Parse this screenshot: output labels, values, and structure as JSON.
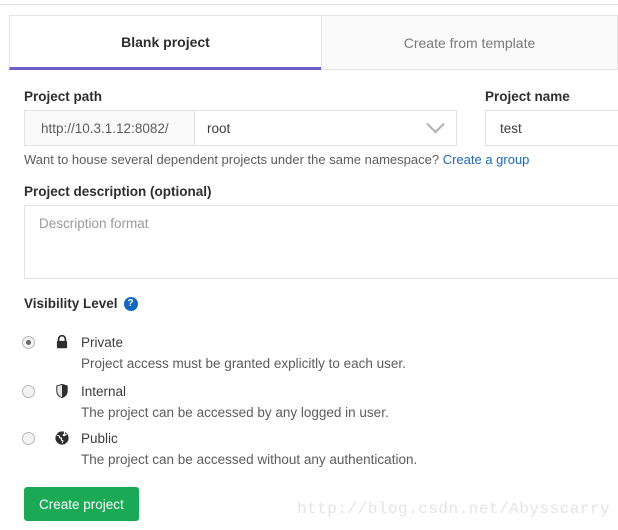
{
  "tabs": [
    {
      "label": "Blank project",
      "active": true
    },
    {
      "label": "Create from template",
      "active": false
    }
  ],
  "form": {
    "project_path": {
      "label": "Project path",
      "prefix": "http://10.3.1.12:8082/",
      "namespace_value": "root",
      "chevron_icon": "chevron-down-icon"
    },
    "project_name": {
      "label": "Project name",
      "value": "test"
    },
    "helper": {
      "text": "Want to house several dependent projects under the same namespace?",
      "link_label": "Create a group",
      "link_color": "#1b69b6"
    },
    "project_description": {
      "label": "Project description (optional)",
      "placeholder": "Description format"
    },
    "visibility": {
      "label": "Visibility Level",
      "help_icon": "question-mark-help-icon",
      "help_icon_glyph": "?",
      "help_icon_color": "#1068bf",
      "options": [
        {
          "id": "private",
          "icon": "lock-icon",
          "title": "Private",
          "description": "Project access must be granted explicitly to each user.",
          "selected": true
        },
        {
          "id": "internal",
          "icon": "shield-icon",
          "title": "Internal",
          "description": "The project can be accessed by any logged in user.",
          "selected": false
        },
        {
          "id": "public",
          "icon": "globe-icon",
          "title": "Public",
          "description": "The project can be accessed without any authentication.",
          "selected": false
        }
      ]
    },
    "submit": {
      "label": "Create project",
      "color": "#1aaa55"
    }
  },
  "watermark": {
    "text": "http://blog.csdn.net/Abysscarry"
  },
  "theme": {
    "active_tab_underline": "#6b5fc7",
    "border": "#e3e3e3"
  }
}
